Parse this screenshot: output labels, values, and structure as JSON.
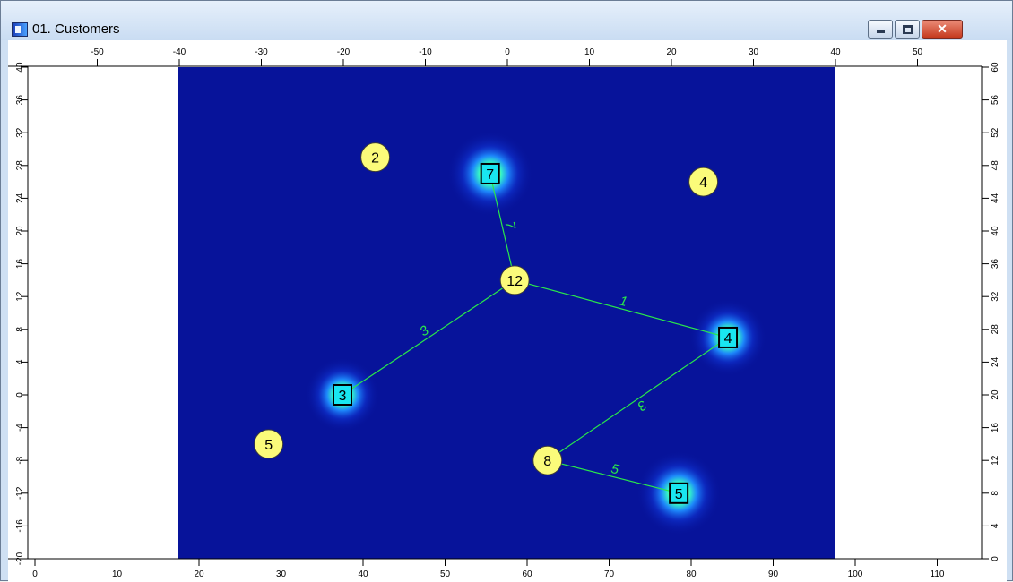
{
  "window": {
    "title": "01. Customers",
    "close_glyph": "✕"
  },
  "icons": {
    "app": "chart-window-icon",
    "minimize": "minimize-icon",
    "maximize": "maximize-icon",
    "close": "close-icon"
  },
  "axes": {
    "top_ticks": [
      "-50",
      "-40",
      "-30",
      "-20",
      "-10",
      "0",
      "10",
      "20",
      "30",
      "40",
      "50"
    ],
    "top_values": [
      -50,
      -40,
      -30,
      -20,
      -10,
      0,
      10,
      20,
      30,
      40,
      50
    ],
    "bottom_ticks": [
      "0",
      "10",
      "20",
      "30",
      "40",
      "50",
      "60",
      "70",
      "80",
      "90",
      "100",
      "110"
    ],
    "bottom_values": [
      0,
      10,
      20,
      30,
      40,
      50,
      60,
      70,
      80,
      90,
      100,
      110
    ],
    "left_ticks": [
      "40",
      "36",
      "32",
      "28",
      "24",
      "20",
      "16",
      "12",
      "8",
      "4",
      "0",
      "-4",
      "-8",
      "-12",
      "-16",
      "-20"
    ],
    "left_values": [
      40,
      36,
      32,
      28,
      24,
      20,
      16,
      12,
      8,
      4,
      0,
      -4,
      -8,
      -12,
      -16,
      -20
    ],
    "right_ticks": [
      "60",
      "56",
      "52",
      "48",
      "44",
      "40",
      "36",
      "32",
      "28",
      "24",
      "20",
      "16",
      "12",
      "8",
      "4",
      "0"
    ],
    "right_values": [
      60,
      56,
      52,
      48,
      44,
      40,
      36,
      32,
      28,
      24,
      20,
      16,
      12,
      8,
      4,
      0
    ]
  },
  "heatmap": {
    "x_range": [
      -40,
      40
    ],
    "y_range": [
      -20,
      40
    ],
    "background": "#07139a",
    "hotspots": [
      {
        "x": -2,
        "y": 27,
        "strength": 1.0
      },
      {
        "x": -20,
        "y": 0,
        "strength": 0.55
      },
      {
        "x": 27,
        "y": 7,
        "strength": 0.65
      },
      {
        "x": 21,
        "y": -12,
        "strength": 0.95
      }
    ]
  },
  "squares": [
    {
      "label": "7",
      "x": -2,
      "y": 27
    },
    {
      "label": "3",
      "x": -20,
      "y": 0
    },
    {
      "label": "4",
      "x": 27,
      "y": 7
    },
    {
      "label": "5",
      "x": 21,
      "y": -12
    }
  ],
  "circles": [
    {
      "label": "2",
      "x": -16,
      "y": 29
    },
    {
      "label": "4",
      "x": 24,
      "y": 26
    },
    {
      "label": "12",
      "x": 1,
      "y": 14
    },
    {
      "label": "5",
      "x": -29,
      "y": -6
    },
    {
      "label": "8",
      "x": 5,
      "y": -8
    }
  ],
  "links": [
    {
      "label": "7",
      "from": [
        -2,
        27
      ],
      "to": [
        1,
        14
      ]
    },
    {
      "label": "3",
      "from": [
        -20,
        0
      ],
      "to": [
        1,
        14
      ]
    },
    {
      "label": "1",
      "from": [
        1,
        14
      ],
      "to": [
        27,
        7
      ]
    },
    {
      "label": "3",
      "from": [
        27,
        7
      ],
      "to": [
        5,
        -8
      ]
    },
    {
      "label": "5",
      "from": [
        5,
        -8
      ],
      "to": [
        21,
        -12
      ]
    }
  ],
  "colors": {
    "line": "#29e84a",
    "circle_fill": "#fbfb7a",
    "square_fill": "#19e6f0",
    "window_close": "#c5391e"
  }
}
